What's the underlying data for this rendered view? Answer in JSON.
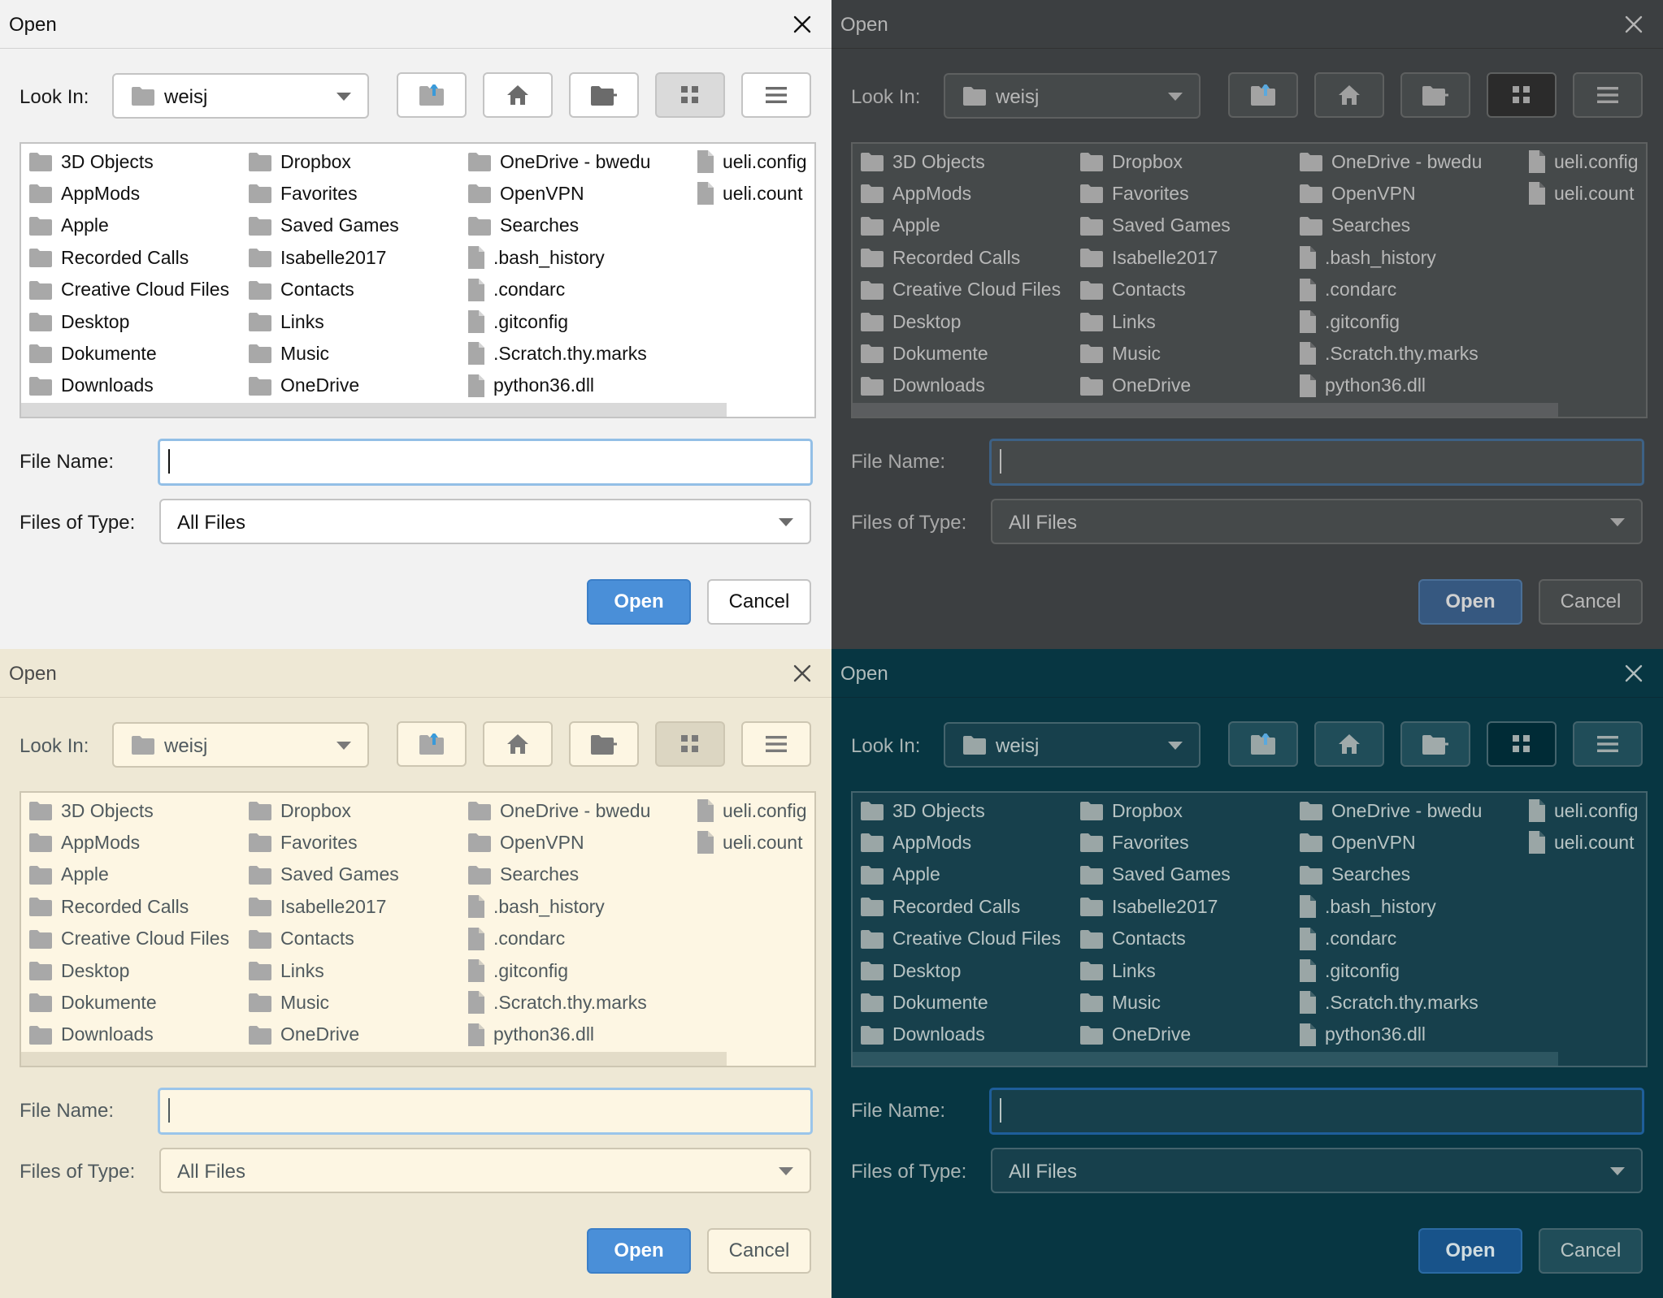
{
  "dialogs": [
    {
      "title": "Open",
      "look_in_label": "Look In:",
      "look_in_value": "weisj",
      "file_name_label": "File Name:",
      "file_name_value": "",
      "files_of_type_label": "Files of Type:",
      "files_of_type_value": "All Files",
      "open_button": "Open",
      "cancel_button": "Cancel",
      "theme": {
        "bg": "#f2f2f2",
        "titlebg": "#f2f2f2",
        "titletext": "#111111",
        "text": "#111111",
        "label": "#1a1a1a",
        "field": "#ffffff",
        "listbg": "#ffffff",
        "border": "#c4c4c4",
        "btn": "#ffffff",
        "sel": "#dadada",
        "icon": "#6b6b6b",
        "focus": "#93bfe6",
        "accent": "#4a8fd8",
        "accentb": "#3b7fc8",
        "accenttext": "#ffffff",
        "scroll": "#d9d9d9",
        "sep": "#d2d2d2",
        "upicon": "#3a9ad9",
        "fileicon": "#a8a8a8",
        "foldericon": "#a8a8a8"
      }
    },
    {
      "title": "Open",
      "look_in_label": "Look In:",
      "look_in_value": "weisj",
      "file_name_label": "File Name:",
      "file_name_value": "",
      "files_of_type_label": "Files of Type:",
      "files_of_type_value": "All Files",
      "open_button": "Open",
      "cancel_button": "Cancel",
      "theme": {
        "bg": "#3c3f41",
        "titlebg": "#3c3f41",
        "titletext": "#b4b4b4",
        "text": "#b8b8b8",
        "label": "#a9a9a9",
        "field": "#45494a",
        "listbg": "#45494a",
        "border": "#5e6060",
        "btn": "#45494a",
        "sel": "#2b2b2b",
        "icon": "#a0a0a0",
        "focus": "#3d6185",
        "accent": "#365880",
        "accentb": "#4a6f97",
        "accenttext": "#d0d0d0",
        "scroll": "#5b5d5f",
        "sep": "#323232",
        "upicon": "#5aa9de",
        "fileicon": "#a3a3a3",
        "foldericon": "#a3a3a3"
      }
    },
    {
      "title": "Open",
      "look_in_label": "Look In:",
      "look_in_value": "weisj",
      "file_name_label": "File Name:",
      "file_name_value": "",
      "files_of_type_label": "Files of Type:",
      "files_of_type_value": "All Files",
      "open_button": "Open",
      "cancel_button": "Cancel",
      "theme": {
        "bg": "#eee8d5",
        "titlebg": "#eee8d5",
        "titletext": "#4a4a4a",
        "text": "#505a5e",
        "label": "#505a5e",
        "field": "#fdf6e3",
        "listbg": "#fdf6e3",
        "border": "#cdc6b2",
        "btn": "#fdf6e3",
        "sel": "#dcd6c2",
        "icon": "#7a7a7a",
        "focus": "#9bc5ea",
        "accent": "#4a8fd8",
        "accentb": "#3b7fc8",
        "accenttext": "#ffffff",
        "scroll": "#e3dcc8",
        "sep": "#d8d1be",
        "upicon": "#3a9ad9",
        "fileicon": "#a8a8a8",
        "foldericon": "#a8a8a8"
      }
    },
    {
      "title": "Open",
      "look_in_label": "Look In:",
      "look_in_value": "weisj",
      "file_name_label": "File Name:",
      "file_name_value": "",
      "files_of_type_label": "Files of Type:",
      "files_of_type_value": "All Files",
      "open_button": "Open",
      "cancel_button": "Cancel",
      "theme": {
        "bg": "#073642",
        "titlebg": "#073642",
        "titletext": "#b0bcbc",
        "text": "#b8c4c4",
        "label": "#a8b4b4",
        "field": "#17404c",
        "listbg": "#17404c",
        "border": "#44646d",
        "btn": "#204d59",
        "sel": "#002b36",
        "icon": "#a0aaaa",
        "focus": "#1e5e9a",
        "accent": "#18538a",
        "accentb": "#2b6aa3",
        "accenttext": "#d0dce0",
        "scroll": "#2d5661",
        "sep": "#0a2c36",
        "upicon": "#5aa9de",
        "fileicon": "#9aa6a6",
        "foldericon": "#9aa6a6"
      }
    }
  ],
  "files": [
    {
      "name": "3D Objects",
      "type": "folder"
    },
    {
      "name": "AppMods",
      "type": "folder"
    },
    {
      "name": "Apple",
      "type": "folder"
    },
    {
      "name": "Recorded Calls",
      "type": "folder"
    },
    {
      "name": "Creative Cloud Files",
      "type": "folder"
    },
    {
      "name": "Desktop",
      "type": "folder"
    },
    {
      "name": "Dokumente",
      "type": "folder"
    },
    {
      "name": "Downloads",
      "type": "folder"
    },
    {
      "name": "Dropbox",
      "type": "folder"
    },
    {
      "name": "Favorites",
      "type": "folder"
    },
    {
      "name": "Saved Games",
      "type": "folder"
    },
    {
      "name": "Isabelle2017",
      "type": "folder"
    },
    {
      "name": "Contacts",
      "type": "folder"
    },
    {
      "name": "Links",
      "type": "folder"
    },
    {
      "name": "Music",
      "type": "folder"
    },
    {
      "name": "OneDrive",
      "type": "folder"
    },
    {
      "name": "OneDrive - bwedu",
      "type": "folder"
    },
    {
      "name": "OpenVPN",
      "type": "folder"
    },
    {
      "name": "Searches",
      "type": "folder"
    },
    {
      "name": ".bash_history",
      "type": "file"
    },
    {
      "name": ".condarc",
      "type": "file"
    },
    {
      "name": ".gitconfig",
      "type": "file"
    },
    {
      "name": ".Scratch.thy.marks",
      "type": "file"
    },
    {
      "name": "python36.dll",
      "type": "file"
    },
    {
      "name": "ueli.config",
      "type": "file"
    },
    {
      "name": "ueli.count",
      "type": "file"
    }
  ],
  "toolbar_icons": [
    "up-folder-icon",
    "home-icon",
    "new-folder-icon",
    "grid-view-icon",
    "list-view-icon"
  ]
}
